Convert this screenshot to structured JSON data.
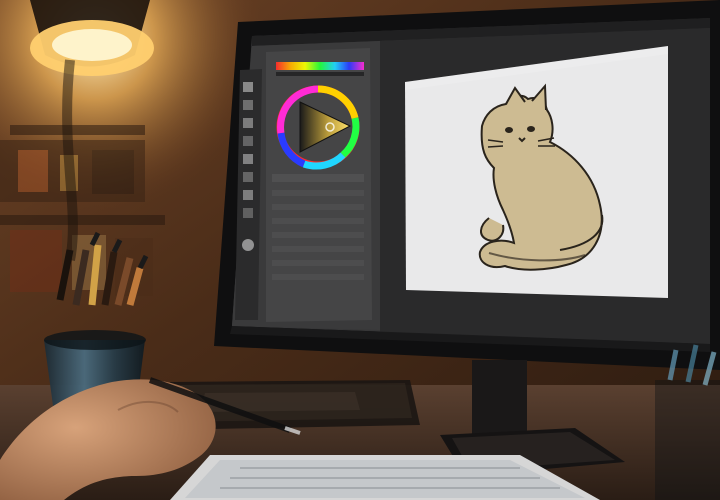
{
  "scene": {
    "subject": "graphics-editor-on-monitor",
    "colors": {
      "wall_dark": "#2a1a10",
      "wall_warm": "#7a4a2a",
      "lamp_glow": "#ffe9a8",
      "monitor_bezel": "#121212",
      "editor_bg": "#3a3a3a",
      "panel_bg": "#474747",
      "canvas_bg": "#e9e9ea",
      "cat_fill": "#cdbb92",
      "cat_stroke": "#2a241c",
      "desk": "#3b2a20",
      "keyboard": "#d7d7d7"
    },
    "icons": [
      "color-wheel-icon",
      "tool-panel-icon",
      "pencil-cup-icon",
      "lamp-icon",
      "keyboard-icon",
      "hand-icon",
      "monitor-icon",
      "cat-drawing-icon"
    ]
  }
}
